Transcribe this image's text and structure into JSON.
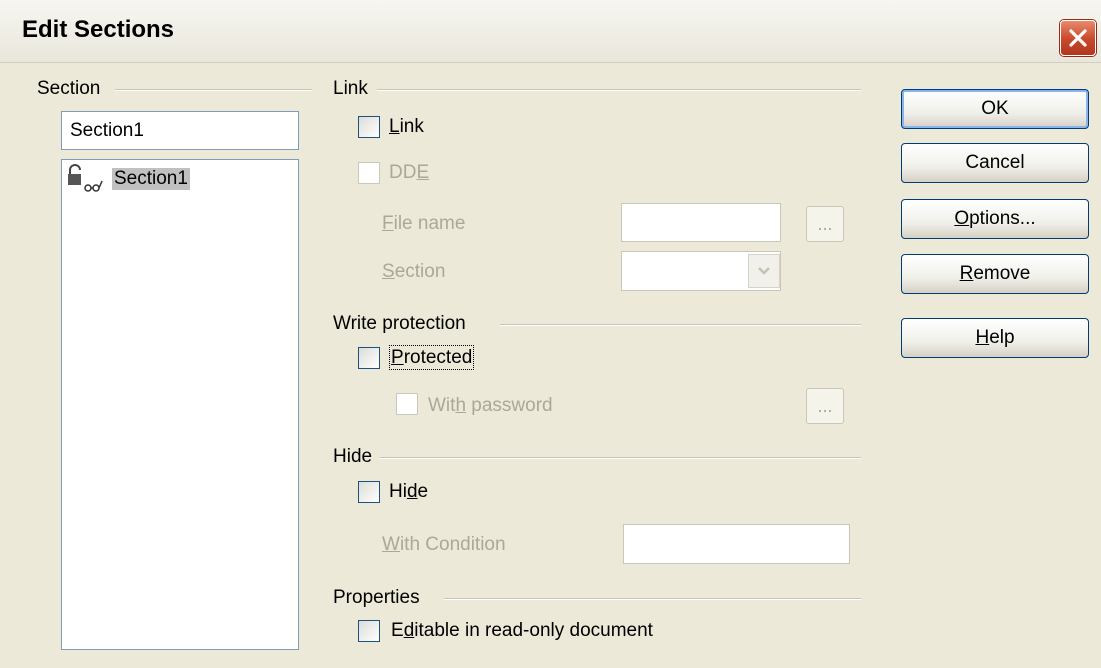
{
  "dialog": {
    "title": "Edit Sections"
  },
  "section_group": {
    "label": "Section",
    "name_value": "Section1",
    "list_items": [
      {
        "label": "Section1",
        "selected": true
      }
    ]
  },
  "link_group": {
    "label": "Link",
    "link_checkbox": {
      "label_pre": "",
      "label_u": "L",
      "label_post": "ink",
      "checked": false
    },
    "dde_checkbox": {
      "label_pre": "DD",
      "label_u": "E",
      "label_post": "",
      "checked": false
    },
    "file_name": {
      "label_pre": "",
      "label_u": "F",
      "label_post": "ile name",
      "value": "",
      "browse": "..."
    },
    "section": {
      "label_pre": "",
      "label_u": "S",
      "label_post": "ection",
      "value": ""
    }
  },
  "write_protection_group": {
    "label": "Write protection",
    "protected_checkbox": {
      "label_pre": "",
      "label_u": "P",
      "label_post": "rotected",
      "checked": false
    },
    "with_password_checkbox": {
      "label_pre": "Wit",
      "label_u": "h",
      "label_post": " password",
      "checked": false,
      "button": "..."
    }
  },
  "hide_group": {
    "label": "Hide",
    "hide_checkbox": {
      "label_pre": "Hi",
      "label_u": "d",
      "label_post": "e",
      "checked": false
    },
    "condition": {
      "label_pre": "",
      "label_u": "W",
      "label_post": "ith Condition",
      "value": ""
    }
  },
  "properties_group": {
    "label": "Properties",
    "editable_checkbox": {
      "label_pre": "E",
      "label_u": "d",
      "label_post": "itable in read-only document",
      "checked": false
    }
  },
  "buttons": {
    "ok": {
      "label_pre": "OK",
      "label_u": "",
      "label_post": ""
    },
    "cancel": {
      "label_pre": "Cancel",
      "label_u": "",
      "label_post": ""
    },
    "options": {
      "label_pre": "",
      "label_u": "O",
      "label_post": "ptions..."
    },
    "remove": {
      "label_pre": "",
      "label_u": "R",
      "label_post": "emove"
    },
    "help": {
      "label_pre": "",
      "label_u": "H",
      "label_post": "elp"
    }
  },
  "colors": {
    "dialog_bg": "#ece9d8",
    "close_button": "#c8482b",
    "disabled_text": "#aca899",
    "selection_bg": "#c0c0c0"
  },
  "icons": {
    "close": "close-icon",
    "section": "section-lock-icon",
    "dropdown": "chevron-down-icon"
  }
}
